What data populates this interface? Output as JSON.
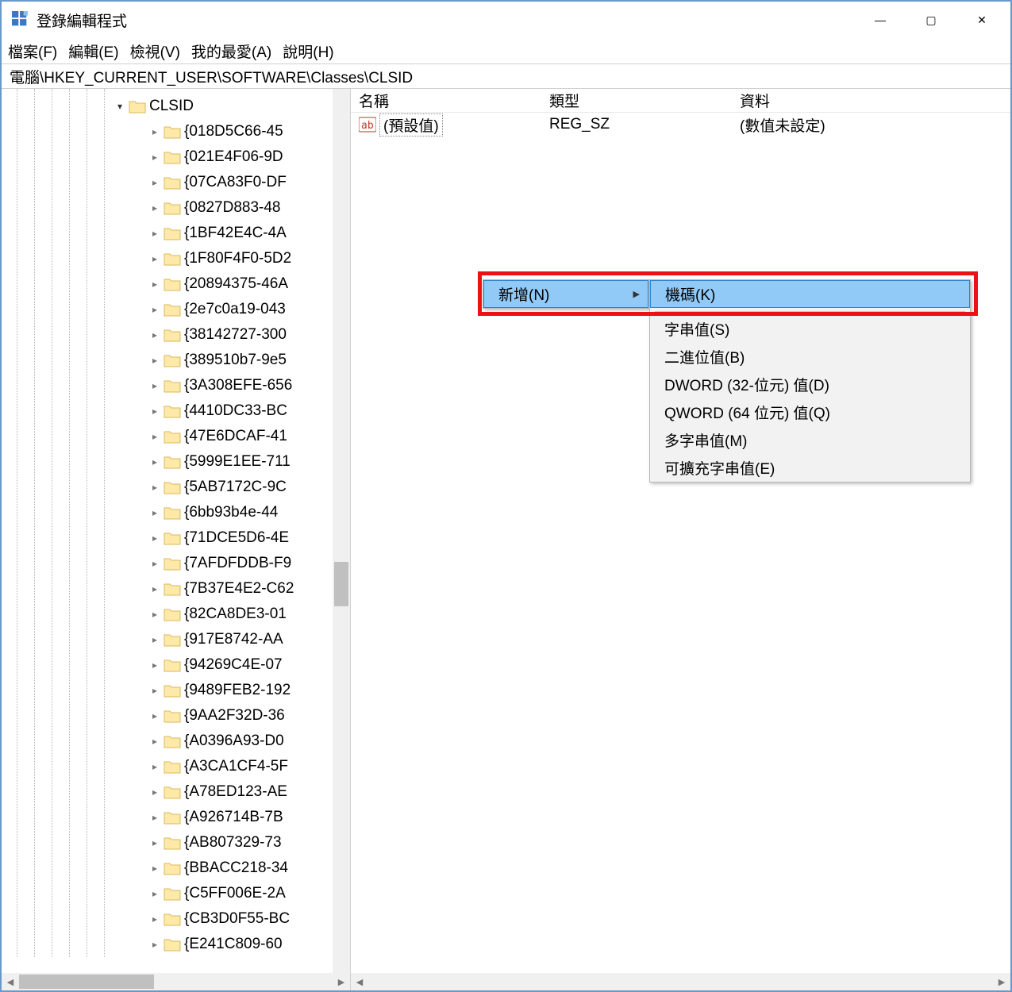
{
  "title": "登錄編輯程式",
  "menus": [
    "檔案(F)",
    "編輯(E)",
    "檢視(V)",
    "我的最愛(A)",
    "說明(H)"
  ],
  "address": "電腦\\HKEY_CURRENT_USER\\SOFTWARE\\Classes\\CLSID",
  "tree_selected": "CLSID",
  "tree_children": [
    "{018D5C66-45",
    "{021E4F06-9D",
    "{07CA83F0-DF",
    "{0827D883-48",
    "{1BF42E4C-4A",
    "{1F80F4F0-5D2",
    "{20894375-46A",
    "{2e7c0a19-043",
    "{38142727-300",
    "{389510b7-9e5",
    "{3A308EFE-656",
    "{4410DC33-BC",
    "{47E6DCAF-41",
    "{5999E1EE-711",
    "{5AB7172C-9C",
    "{6bb93b4e-44",
    "{71DCE5D6-4E",
    "{7AFDFDDB-F9",
    "{7B37E4E2-C62",
    "{82CA8DE3-01",
    "{917E8742-AA",
    "{94269C4E-07",
    "{9489FEB2-192",
    "{9AA2F32D-36",
    "{A0396A93-D0",
    "{A3CA1CF4-5F",
    "{A78ED123-AE",
    "{A926714B-7B",
    "{AB807329-73",
    "{BBACC218-34",
    "{C5FF006E-2A",
    "{CB3D0F55-BC",
    "{E241C809-60"
  ],
  "value_columns": {
    "name": "名稱",
    "type": "類型",
    "data": "資料"
  },
  "value_row": {
    "name": "(預設值)",
    "type": "REG_SZ",
    "data": "(數值未設定)"
  },
  "ctx_primary": {
    "label": "新增(N)"
  },
  "ctx_new_items": [
    "機碼(K)",
    "字串值(S)",
    "二進位值(B)",
    "DWORD (32-位元) 值(D)",
    "QWORD (64 位元) 值(Q)",
    "多字串值(M)",
    "可擴充字串值(E)"
  ],
  "win_controls": {
    "min": "—",
    "max": "▢",
    "close": "✕"
  }
}
